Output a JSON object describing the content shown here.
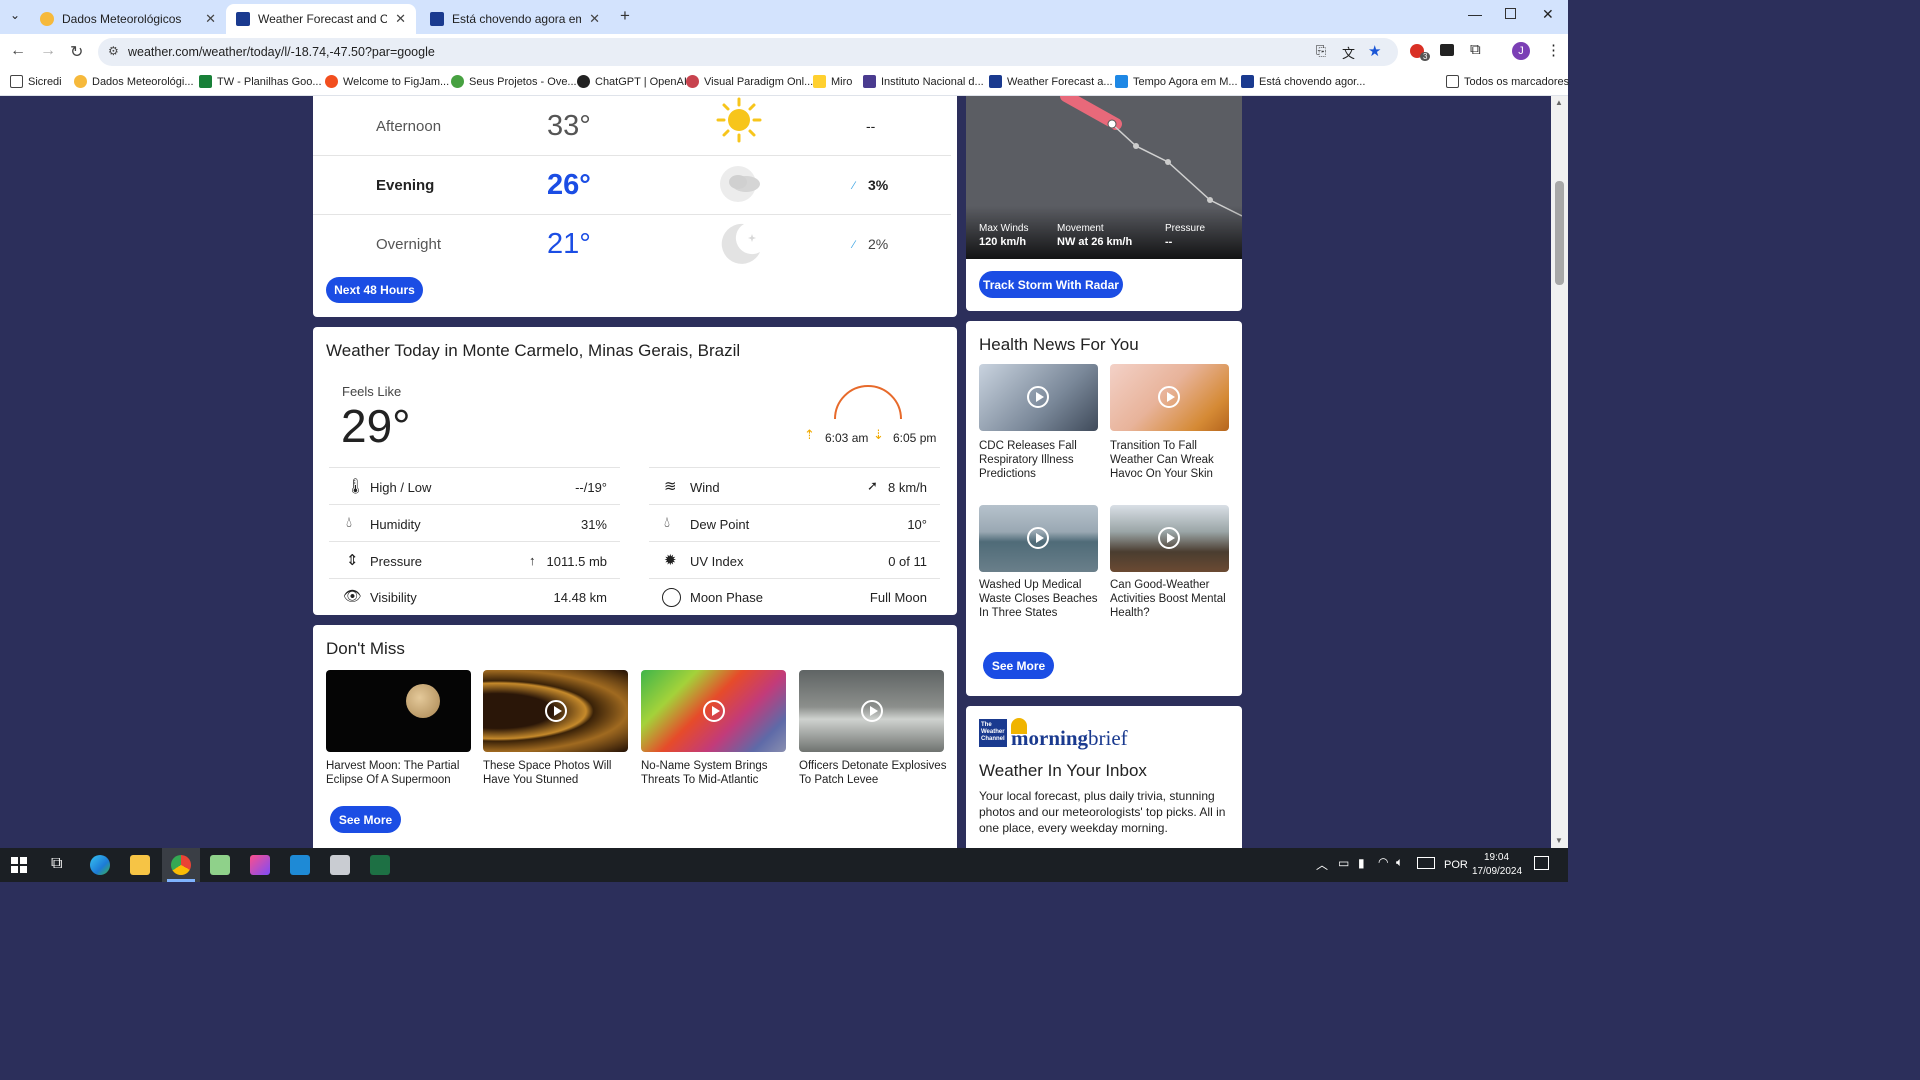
{
  "browser": {
    "tabs": [
      {
        "title": "Dados Meteorológicos",
        "active": false
      },
      {
        "title": "Weather Forecast and Conditions",
        "active": true
      },
      {
        "title": "Está chovendo agora em Monte",
        "active": false
      }
    ],
    "url": "weather.com/weather/today/l/-18.74,-47.50?par=google",
    "bookmarks": [
      "Sicredi",
      "Dados Meteorológi...",
      "TW - Planilhas Goo...",
      "Welcome to FigJam...",
      "Seus Projetos - Ove...",
      "ChatGPT | OpenAI",
      "Visual Paradigm Onl...",
      "Miro",
      "Instituto Nacional d...",
      "Weather Forecast a...",
      "Tempo Agora em M...",
      "Está chovendo agor..."
    ],
    "all_bookmarks": "Todos os marcadores",
    "extension_badge": "3",
    "profile_initial": "J"
  },
  "forecast": {
    "rows": [
      {
        "label": "Afternoon",
        "temp": "33°",
        "precip": "--",
        "icon": "sun-icon"
      },
      {
        "label": "Evening",
        "temp": "26°",
        "precip": "3%",
        "icon": "partly-cloudy-night-icon"
      },
      {
        "label": "Overnight",
        "temp": "21°",
        "precip": "2%",
        "icon": "moon-icon"
      }
    ],
    "button": "Next 48 Hours"
  },
  "storm": {
    "max_winds_label": "Max Winds",
    "max_winds": "120 km/h",
    "movement_label": "Movement",
    "movement": "NW at 26 km/h",
    "pressure_label": "Pressure",
    "pressure": "--",
    "button": "Track Storm With Radar"
  },
  "today": {
    "title": "Weather Today in Monte Carmelo, Minas Gerais, Brazil",
    "feels_like_label": "Feels Like",
    "feels_like": "29°",
    "sunrise": "6:03 am",
    "sunset": "6:05 pm",
    "left": [
      {
        "label": "High / Low",
        "value": "--/19°",
        "icon": "thermometer-icon"
      },
      {
        "label": "Humidity",
        "value": "31%",
        "icon": "humidity-icon"
      },
      {
        "label": "Pressure",
        "value": "1011.5 mb",
        "icon": "pressure-icon"
      },
      {
        "label": "Visibility",
        "value": "14.48 km",
        "icon": "visibility-icon"
      }
    ],
    "right": [
      {
        "label": "Wind",
        "value": "8 km/h",
        "icon": "wind-icon"
      },
      {
        "label": "Dew Point",
        "value": "10°",
        "icon": "dew-point-icon"
      },
      {
        "label": "UV Index",
        "value": "0 of 11",
        "icon": "uv-icon"
      },
      {
        "label": "Moon Phase",
        "value": "Full Moon",
        "icon": "moon-phase-icon"
      }
    ]
  },
  "dont_miss": {
    "title": "Don't Miss",
    "items": [
      "Harvest Moon: The Partial Eclipse Of A Supermoon",
      "These Space Photos Will Have You Stunned",
      "No-Name System Brings Threats To Mid-Atlantic",
      "Officers Detonate Explosives To Patch Levee"
    ],
    "button": "See More"
  },
  "health": {
    "title": "Health News For You",
    "items": [
      "CDC Releases Fall Respiratory Illness Predictions",
      "Transition To Fall Weather Can Wreak Havoc On Your Skin",
      "Washed Up Medical Waste Closes Beaches In Three States",
      "Can Good-Weather Activities Boost Mental Health?"
    ],
    "button": "See More"
  },
  "newsletter": {
    "logo_top": "The Weather Channel",
    "logo_word": "morning",
    "logo_word2": "brief",
    "title": "Weather In Your Inbox",
    "body": "Your local forecast, plus daily trivia, stunning photos and our meteorologists' top picks. All in one place, every weekday morning."
  },
  "taskbar": {
    "lang": "POR",
    "time": "19:04",
    "date": "17/09/2024"
  }
}
